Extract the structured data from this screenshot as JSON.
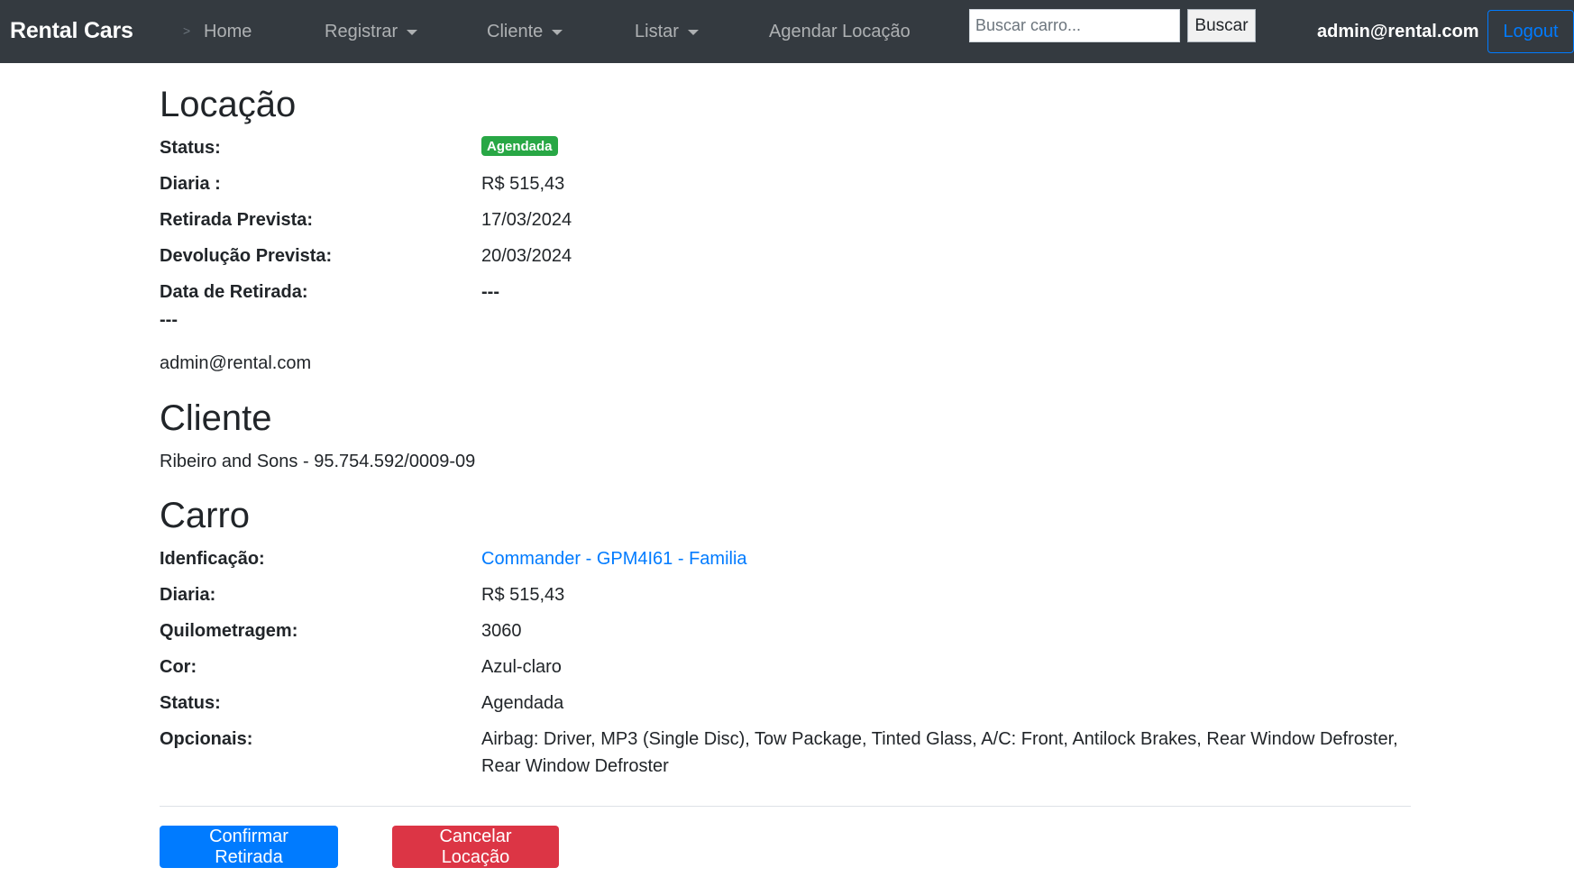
{
  "navbar": {
    "brand": "Rental Cars",
    "toggle_mark": ">",
    "home": "Home",
    "registrar": "Registrar",
    "cliente": "Cliente",
    "listar": "Listar",
    "agendar": "Agendar Locação",
    "search_placeholder": "Buscar carro...",
    "search_button": "Buscar",
    "user_email": "admin@rental.com",
    "logout": "Logout"
  },
  "locacao": {
    "title": "Locação",
    "status_label": "Status:",
    "status_badge": "Agendada",
    "diaria_label": "Diaria :",
    "diaria_value": "R$ 515,43",
    "retirada_prevista_label": "Retirada Prevista:",
    "retirada_prevista_value": "17/03/2024",
    "devolucao_prevista_label": "Devolução Prevista:",
    "devolucao_prevista_value": "20/03/2024",
    "data_retirada_label": "Data de Retirada:",
    "data_retirada_value": "---",
    "extra_dashes": "---",
    "user": "admin@rental.com"
  },
  "cliente": {
    "title": "Cliente",
    "info": "Ribeiro and Sons - 95.754.592/0009-09"
  },
  "carro": {
    "title": "Carro",
    "identificacao_label": "Idenficação:",
    "identificacao_value": "Commander - GPM4I61 - Familia",
    "diaria_label": "Diaria:",
    "diaria_value": "R$ 515,43",
    "quilometragem_label": "Quilometragem:",
    "quilometragem_value": "3060",
    "cor_label": "Cor:",
    "cor_value": "Azul-claro",
    "status_label": "Status:",
    "status_value": "Agendada",
    "opcionais_label": "Opcionais:",
    "opcionais_value": "Airbag: Driver, MP3 (Single Disc), Tow Package, Tinted Glass, A/C: Front, Antilock Brakes, Rear Window Defroster, Rear Window Defroster"
  },
  "actions": {
    "confirmar": "Confirmar Retirada",
    "cancelar": "Cancelar Locação"
  },
  "colors": {
    "navbar_bg": "#343a40",
    "primary": "#007bff",
    "danger": "#dc3545",
    "success": "#28a745"
  }
}
